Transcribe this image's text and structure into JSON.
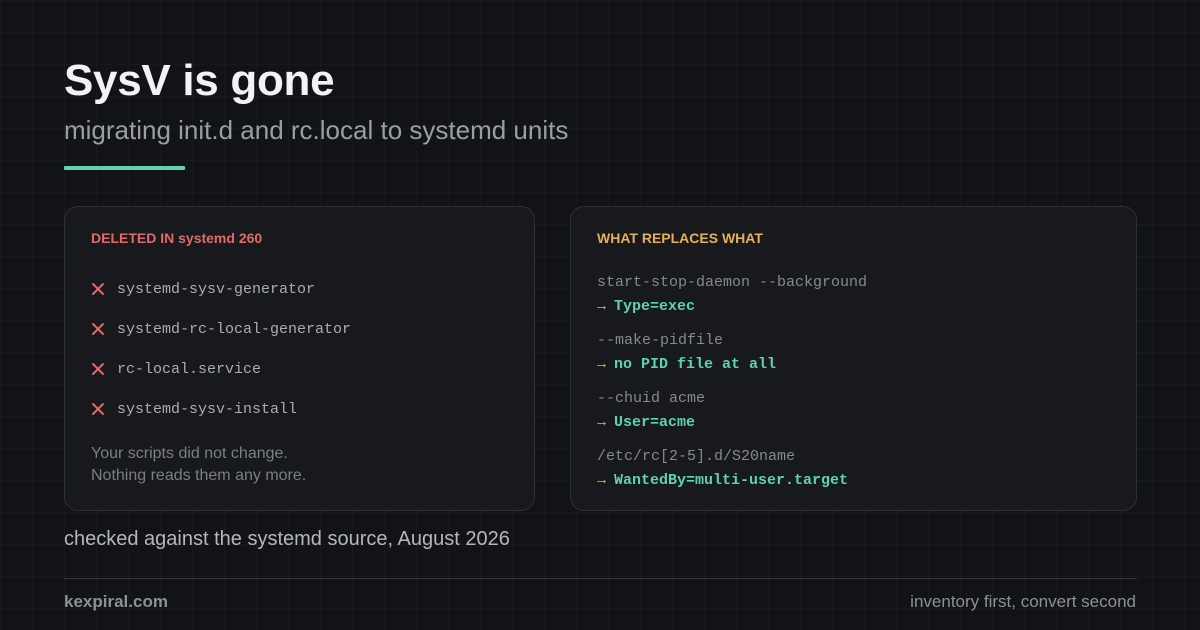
{
  "header": {
    "title": "SysV is gone",
    "subtitle": "migrating init.d and rc.local to systemd units"
  },
  "deleted_card": {
    "heading": "DELETED IN systemd 260",
    "items": [
      "systemd-sysv-generator",
      "systemd-rc-local-generator",
      "rc-local.service",
      "systemd-sysv-install"
    ],
    "note_line1": "Your scripts did not change.",
    "note_line2": "Nothing reads them any more."
  },
  "replaces_card": {
    "heading": "WHAT REPLACES WHAT",
    "arrow": "→",
    "pairs": [
      {
        "old": "start-stop-daemon --background",
        "new": "Type=exec"
      },
      {
        "old": "--make-pidfile",
        "new": "no PID file at all"
      },
      {
        "old": "--chuid acme",
        "new": "User=acme"
      },
      {
        "old": "/etc/rc[2-5].d/S20name",
        "new": "WantedBy=multi-user.target"
      }
    ]
  },
  "footnote": "checked against the systemd source, August 2026",
  "footer": {
    "brand": "kexpiral.com",
    "tagline": "inventory first, convert second"
  },
  "colors": {
    "accent": "#5ed3ad",
    "deleted": "#e06a6a",
    "replaces": "#e5b05c",
    "background": "#121316"
  },
  "icons": {
    "deleted_marker": "x-icon",
    "replacement_marker": "right-arrow"
  }
}
